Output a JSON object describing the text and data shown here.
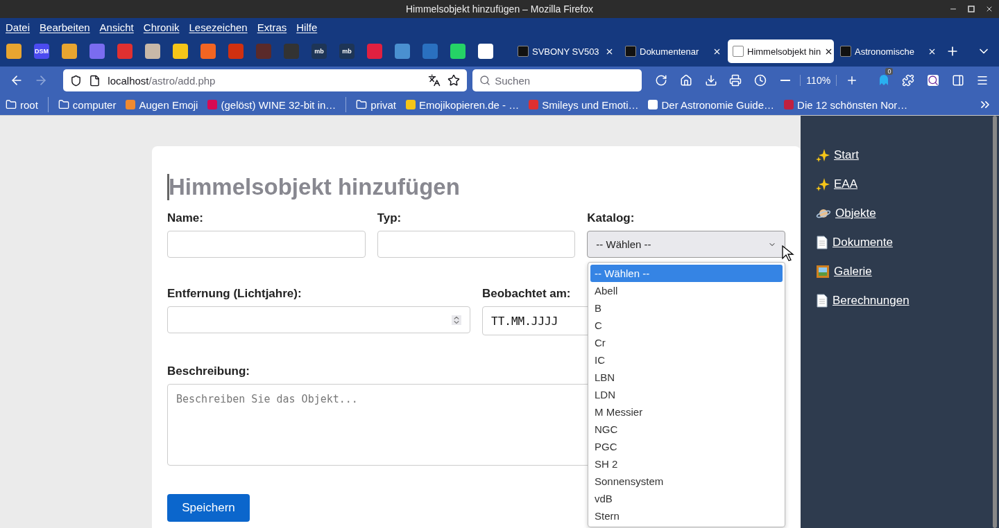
{
  "window": {
    "title": "Himmelsobjekt hinzufügen – Mozilla Firefox"
  },
  "menu": [
    "Datei",
    "Bearbeiten",
    "Ansicht",
    "Chronik",
    "Lesezeichen",
    "Extras",
    "Hilfe"
  ],
  "pinned_tabs": [
    {
      "color": "#e8a530"
    },
    {
      "color": "#4b4bf0",
      "label": "DSM"
    },
    {
      "color": "#e8a530"
    },
    {
      "color": "#7a6cf0"
    },
    {
      "color": "#e03030"
    },
    {
      "color": "#c8b8a8"
    },
    {
      "color": "#f5c518"
    },
    {
      "color": "#f26522"
    },
    {
      "color": "#d03010"
    },
    {
      "color": "#5a2a2a"
    },
    {
      "color": "#333333"
    },
    {
      "color": "#1e3556",
      "label": "mb"
    },
    {
      "color": "#1e3556",
      "label": "mb"
    },
    {
      "color": "#e02040"
    },
    {
      "color": "#4a90d0"
    },
    {
      "color": "#2a70c0"
    },
    {
      "color": "#25d366"
    },
    {
      "color": "#ffffff"
    }
  ],
  "tabs": [
    {
      "label": "SVBONY SV503",
      "selected": false
    },
    {
      "label": "Dokumentenar",
      "selected": false
    },
    {
      "label": "Himmelsobjekt hin",
      "selected": true
    },
    {
      "label": "Astronomische",
      "selected": false
    }
  ],
  "navigation": {
    "url_host": "localhost",
    "url_path": "/astro/add.php",
    "search_placeholder": "Suchen",
    "zoom": "110%",
    "extension_badge": "0"
  },
  "bookmarks": [
    {
      "kind": "folder",
      "label": "root"
    },
    {
      "kind": "separator"
    },
    {
      "kind": "folder",
      "label": "computer"
    },
    {
      "kind": "site",
      "label": "Augen Emoji",
      "color": "#f08a30"
    },
    {
      "kind": "site",
      "label": "(gelöst) WINE 32-bit in…",
      "color": "#d70a53"
    },
    {
      "kind": "separator"
    },
    {
      "kind": "folder",
      "label": "privat"
    },
    {
      "kind": "site",
      "label": "Emojikopieren.de - …",
      "color": "#f5c518"
    },
    {
      "kind": "site",
      "label": "Smileys und Emoti…",
      "color": "#e03030"
    },
    {
      "kind": "site",
      "label": "Der Astronomie Guide…",
      "color": "#ffffff"
    },
    {
      "kind": "site",
      "label": "Die 12 schönsten Nor…",
      "color": "#c02040"
    }
  ],
  "form": {
    "heading": "Himmelsobjekt hinzufügen",
    "fields": [
      {
        "label": "Name:",
        "kind": "text"
      },
      {
        "label": "Typ:",
        "kind": "text"
      },
      {
        "label": "Katalog:",
        "kind": "select",
        "value": "-- Wählen --",
        "expanded": true
      }
    ],
    "fields_row_2": [
      {
        "label": "Entfernung (Lichtjahre):",
        "kind": "number"
      },
      {
        "label": "Beobachtet am:",
        "kind": "date",
        "value": "TT.MM.JJJJ"
      }
    ],
    "description": {
      "label": "Beschreibung:",
      "placeholder": "Beschreiben Sie das Objekt..."
    },
    "submit": "Speichern",
    "catalog_options": [
      {
        "label": "-- Wählen --",
        "selected": true
      },
      {
        "label": "Abell",
        "selected": false
      },
      {
        "label": "B",
        "selected": false
      },
      {
        "label": "C",
        "selected": false
      },
      {
        "label": "Cr",
        "selected": false
      },
      {
        "label": "IC",
        "selected": false
      },
      {
        "label": "LBN",
        "selected": false
      },
      {
        "label": "LDN",
        "selected": false
      },
      {
        "label": "M Messier",
        "selected": false
      },
      {
        "label": "NGC",
        "selected": false
      },
      {
        "label": "PGC",
        "selected": false
      },
      {
        "label": "SH 2",
        "selected": false
      },
      {
        "label": "Sonnensystem",
        "selected": false
      },
      {
        "label": "vdB",
        "selected": false
      },
      {
        "label": "Stern",
        "selected": false
      }
    ]
  },
  "sidebar": [
    {
      "kind": "sparkles",
      "label": "Start"
    },
    {
      "kind": "sparkles",
      "label": "EAA"
    },
    {
      "kind": "planet",
      "label": "Objekte"
    },
    {
      "kind": "document",
      "label": "Dokumente"
    },
    {
      "kind": "gallery",
      "label": "Galerie"
    },
    {
      "kind": "document",
      "label": "Berechnungen"
    }
  ]
}
